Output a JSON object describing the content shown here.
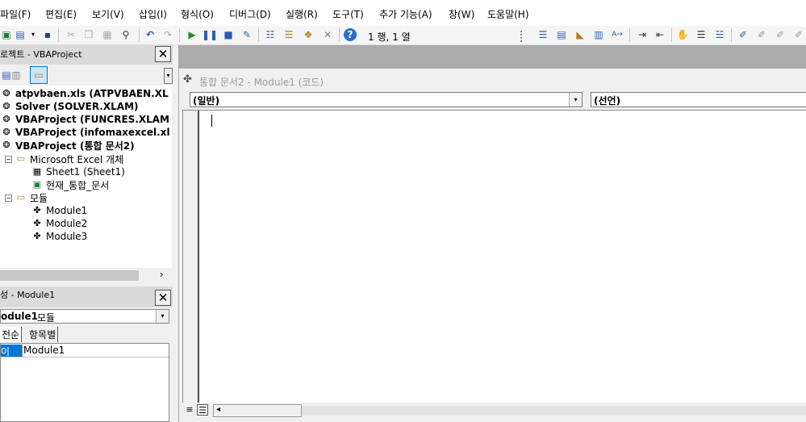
{
  "menu": [
    {
      "label": "파일(F)",
      "key": "file"
    },
    {
      "label": "편집(E)",
      "key": "edit"
    },
    {
      "label": "보기(V)",
      "key": "view"
    },
    {
      "label": "삽입(I)",
      "key": "insert"
    },
    {
      "label": "형식(O)",
      "key": "format"
    },
    {
      "label": "디버그(D)",
      "key": "debug"
    },
    {
      "label": "실행(R)",
      "key": "run"
    },
    {
      "label": "도구(T)",
      "key": "tools"
    },
    {
      "label": "추가 기능(A)",
      "key": "addins"
    },
    {
      "label": "창(W)",
      "key": "window"
    },
    {
      "label": "도움말(H)",
      "key": "help"
    }
  ],
  "toolbar": {
    "position_text": "1 행, 1 열"
  },
  "project_panel": {
    "title": "로젝트 - VBAProject",
    "projects": [
      "atpvbaen.xls (ATPVBAEN.XL",
      "Solver (SOLVER.XLAM)",
      "VBAProject (FUNCRES.XLAM",
      "VBAProject (infomaxexcel.xl",
      "VBAProject (통합 문서2)"
    ],
    "folders": {
      "excel_objects": "Microsoft Excel 개체",
      "sheet1": "Sheet1 (Sheet1)",
      "workbook": "현재_통합_문서",
      "modules": "모듈",
      "module_items": [
        "Module1",
        "Module2",
        "Module3"
      ]
    }
  },
  "properties_panel": {
    "title": "성 - Module1",
    "object_name": "odule1",
    "object_type": "모듈",
    "tab_alpha": "전순",
    "tab_category": "항목별",
    "property_name": "이름)",
    "property_value": "Module1"
  },
  "code_window": {
    "title": "통합 문서2 - Module1 (코드)",
    "object_combo": "(일반)",
    "procedure_combo": "(선언)"
  },
  "colors": {
    "selected": "#0078d7",
    "mdi_background": "#ababab",
    "margin_border": "#4a4a4a"
  }
}
